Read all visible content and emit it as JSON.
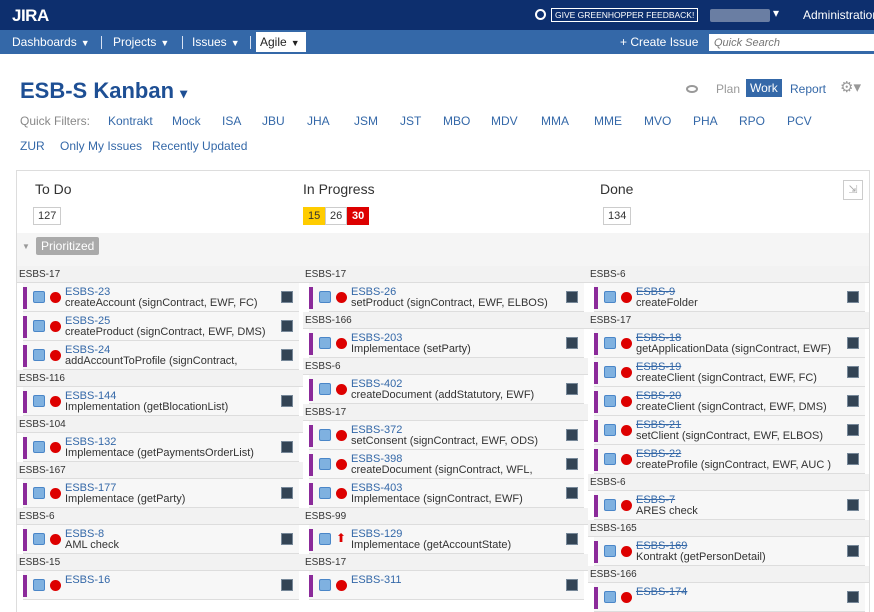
{
  "header": {
    "logo": "JIRA",
    "feedback": "GIVE GREENHOPPER FEEDBACK!",
    "user_caret": "▾",
    "admin": "Administration"
  },
  "nav": {
    "dashboards": "Dashboards",
    "projects": "Projects",
    "issues": "Issues",
    "agile": "Agile",
    "create_issue": "+ Create Issue",
    "search_placeholder": "Quick Search"
  },
  "board": {
    "title": "ESB-S Kanban",
    "title_caret": "▾",
    "modes": {
      "plan": "Plan",
      "work": "Work",
      "report": "Report"
    },
    "gear": "⚙▾",
    "quick_filters_label": "Quick Filters:",
    "quick_filters": [
      "Kontrakt",
      "Mock",
      "ISA",
      "JBU",
      "JHA",
      "JSM",
      "JST",
      "MBO",
      "MDV",
      "MMA",
      "MME",
      "MVO",
      "PHA",
      "RPO",
      "PCV",
      "ZUR",
      "Only My Issues",
      "Recently Updated"
    ],
    "swimlane": "Prioritized",
    "columns": [
      {
        "title": "To Do",
        "counts": [
          "127"
        ],
        "groups": [
          {
            "epic": "ESBS-17",
            "cards": [
              {
                "key": "ESBS-23",
                "summary": "createAccount (signContract, EWF, FC)"
              },
              {
                "key": "ESBS-25",
                "summary": "createProduct (signContract, EWF, DMS)"
              },
              {
                "key": "ESBS-24",
                "summary": "addAccountToProfile (signContract,"
              }
            ]
          },
          {
            "epic": "ESBS-116",
            "cards": [
              {
                "key": "ESBS-144",
                "summary": "Implementation (getBlocationList)"
              }
            ]
          },
          {
            "epic": "ESBS-104",
            "cards": [
              {
                "key": "ESBS-132",
                "summary": "Implementace (getPaymentsOrderList)"
              }
            ]
          },
          {
            "epic": "ESBS-167",
            "cards": [
              {
                "key": "ESBS-177",
                "summary": "Implementace (getParty)"
              }
            ]
          },
          {
            "epic": "ESBS-6",
            "cards": [
              {
                "key": "ESBS-8",
                "summary": "AML check"
              }
            ]
          },
          {
            "epic": "ESBS-15",
            "cards": [
              {
                "key": "ESBS-16",
                "summary": ""
              }
            ]
          }
        ]
      },
      {
        "title": "In Progress",
        "counts": [
          "15",
          "26",
          "30"
        ],
        "groups": [
          {
            "epic": "ESBS-17",
            "cards": [
              {
                "key": "ESBS-26",
                "summary": "setProduct (signContract, EWF, ELBOS)"
              }
            ]
          },
          {
            "epic": "ESBS-166",
            "cards": [
              {
                "key": "ESBS-203",
                "summary": "Implementace (setParty)"
              }
            ]
          },
          {
            "epic": "ESBS-6",
            "cards": [
              {
                "key": "ESBS-402",
                "summary": "createDocument (addStatutory, EWF)"
              }
            ]
          },
          {
            "epic": "ESBS-17",
            "cards": [
              {
                "key": "ESBS-372",
                "summary": "setConsent (signContract, EWF, ODS)"
              },
              {
                "key": "ESBS-398",
                "summary": "createDocument (signContract, WFL,"
              },
              {
                "key": "ESBS-403",
                "summary": "Implementace (signContract, EWF)"
              }
            ]
          },
          {
            "epic": "ESBS-99",
            "cards": [
              {
                "key": "ESBS-129",
                "summary": "Implementace (getAccountState)"
              }
            ]
          },
          {
            "epic": "ESBS-17",
            "cards": [
              {
                "key": "ESBS-311",
                "summary": ""
              }
            ]
          }
        ]
      },
      {
        "title": "Done",
        "counts": [
          "134"
        ],
        "groups": [
          {
            "epic": "ESBS-6",
            "cards": [
              {
                "key": "ESBS-9",
                "summary": "createFolder"
              }
            ]
          },
          {
            "epic": "ESBS-17",
            "cards": [
              {
                "key": "ESBS-18",
                "summary": "getApplicationData (signContract, EWF)"
              },
              {
                "key": "ESBS-19",
                "summary": "createClient (signContract, EWF, FC)"
              },
              {
                "key": "ESBS-20",
                "summary": "createClient (signContract, EWF, DMS)"
              },
              {
                "key": "ESBS-21",
                "summary": "setClient (signContract, EWF, ELBOS)"
              },
              {
                "key": "ESBS-22",
                "summary": "createProfile (signContract, EWF, AUC )"
              }
            ]
          },
          {
            "epic": "ESBS-6",
            "cards": [
              {
                "key": "ESBS-7",
                "summary": "ARES check"
              }
            ]
          },
          {
            "epic": "ESBS-165",
            "cards": [
              {
                "key": "ESBS-169",
                "summary": "Kontrakt (getPersonDetail)"
              }
            ]
          },
          {
            "epic": "ESBS-166",
            "cards": [
              {
                "key": "ESBS-174",
                "summary": ""
              }
            ]
          }
        ]
      }
    ]
  }
}
